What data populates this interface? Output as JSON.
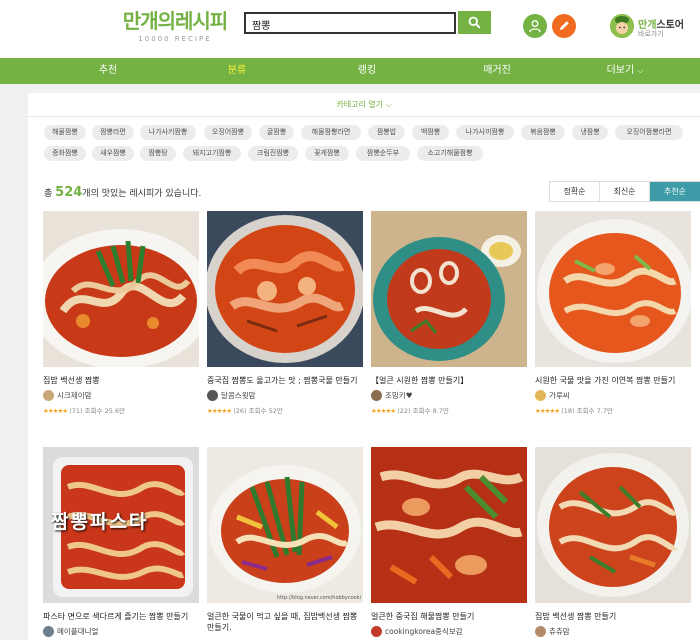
{
  "header": {
    "logo_main": "만개의레시피",
    "logo_sub": "10000 RECIPE",
    "search_value": "짬뽕",
    "store_title_a": "만개",
    "store_title_b": "스토어",
    "store_sub": "바로가기"
  },
  "nav": [
    {
      "label": "추천"
    },
    {
      "label": "분류"
    },
    {
      "label": "랭킹"
    },
    {
      "label": "매거진"
    },
    {
      "label": "더보기"
    }
  ],
  "category_open": "카테고리 열기",
  "tags_row1": [
    "해물짬뽕",
    "짬뽕라면",
    "나가사키짬뽕",
    "오징어짬뽕",
    "굴짬뽕",
    "해물짬뽕라면",
    "짬뽕밥",
    "백짬뽕",
    "나가사끼짬뽕",
    "볶음짬뽕",
    "냉짬뽕",
    "오징어짬뽕라면"
  ],
  "tags_row2": [
    "중화짬뽕",
    "새우짬뽕",
    "짬뽕탕",
    "돼지고기짬뽕",
    "크림진짬뽕",
    "꽃게짬뽕",
    "짬뽕순두부",
    "소고기해물짬뽕"
  ],
  "count_prefix": "총",
  "count_value": "524",
  "count_suffix": "개의 맛있는 레시피가 있습니다.",
  "sort": [
    {
      "label": "정확순"
    },
    {
      "label": "최신순"
    },
    {
      "label": "추천순"
    }
  ],
  "recipes": [
    {
      "title": "집밥 백선생 짬뽕",
      "author": "시크제이맘",
      "stars": "★★★★★",
      "reviews": "(71)",
      "views": "조회수 25.6만"
    },
    {
      "title": "중국집 짬뽕도 울고가는 맛 ; 짬뽕국물 만들기",
      "author": "달콤스윗맘",
      "stars": "★★★★★",
      "reviews": "(26)",
      "views": "조회수 52만"
    },
    {
      "title": "【얼큰 시원한 짬뽕 만들기】",
      "author": "조밍키♥",
      "stars": "★★★★★",
      "reviews": "(22)",
      "views": "조회수 8.7만"
    },
    {
      "title": "시원한 국물 맛을 가진 이연복 짬뽕 만들기",
      "author": "가루씨",
      "stars": "★★★★★",
      "reviews": "(18)",
      "views": "조회수 7.7만"
    },
    {
      "title": "파스타 면으로 색다르게 즐기는 짬뽕 만들기",
      "author": "메이플대니얼",
      "overlay": "짬뽕파스타"
    },
    {
      "title": "얼큰한 국물이 먹고 싶을 때, 집밥백선생 짬뽕 만들기.",
      "author": "",
      "watermark": "http://blog.naver.com/hobbycooki"
    },
    {
      "title": "얼큰한 중국집 해물짬뽕 만들기",
      "author": "cookingkorea중식보감"
    },
    {
      "title": "집밥 백선생 짬뽕 만들기",
      "author": "츄츄맘"
    }
  ]
}
